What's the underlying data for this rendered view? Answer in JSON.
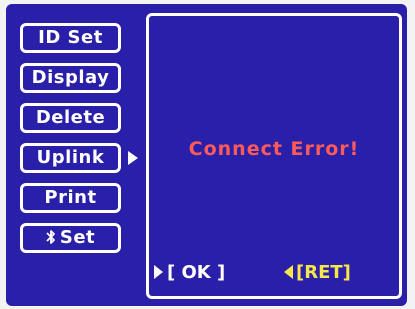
{
  "menu": {
    "items": [
      {
        "label": "ID Set"
      },
      {
        "label": "Display"
      },
      {
        "label": "Delete"
      },
      {
        "label": "Uplink",
        "selected": true
      },
      {
        "label": "Print"
      },
      {
        "label": "Set",
        "icon": "bluetooth-icon"
      }
    ]
  },
  "panel": {
    "message": "Connect Error!"
  },
  "hints": {
    "ok": "[ OK ]",
    "ret": "[RET]"
  },
  "colors": {
    "background": "#2a1fa8",
    "menu_text": "#ffffff",
    "error_text": "#ff5a5a",
    "ret_hint": "#f5e64a"
  }
}
